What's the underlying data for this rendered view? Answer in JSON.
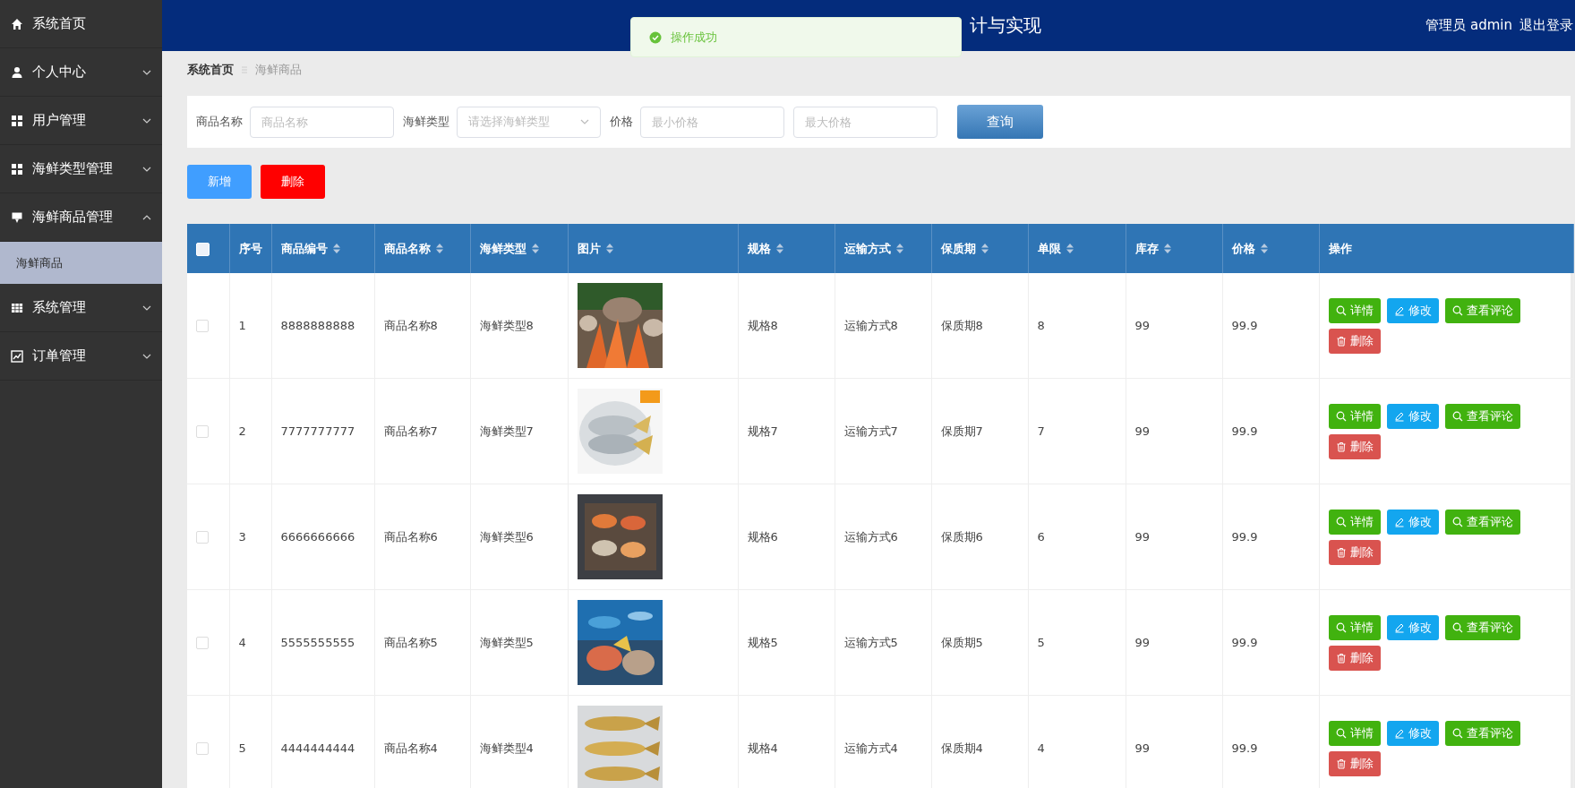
{
  "sidebar": {
    "items": [
      {
        "kind": "link",
        "label": "系统首页"
      },
      {
        "kind": "menu",
        "label": "个人中心",
        "expanded": false
      },
      {
        "kind": "menu",
        "label": "用户管理",
        "expanded": false
      },
      {
        "kind": "menu",
        "label": "海鲜类型管理",
        "expanded": false
      },
      {
        "kind": "menu",
        "label": "海鲜商品管理",
        "expanded": true,
        "children": [
          {
            "label": "海鲜商品",
            "selected": true
          }
        ]
      },
      {
        "kind": "menu",
        "label": "系统管理",
        "expanded": false
      },
      {
        "kind": "menu",
        "label": "订单管理",
        "expanded": false
      }
    ]
  },
  "header": {
    "title": "计与实现",
    "user": "管理员 admin",
    "logout": "退出登录"
  },
  "toast": {
    "kind": "success",
    "message": "操作成功"
  },
  "breadcrumb": [
    "系统首页",
    "海鲜商品"
  ],
  "search": {
    "fields": [
      {
        "kind": "input",
        "label": "商品名称",
        "placeholder": "商品名称"
      },
      {
        "kind": "select",
        "label": "海鲜类型",
        "placeholder": "请选择海鲜类型"
      },
      {
        "kind": "input",
        "label": "价格",
        "placeholder": "最小价格"
      },
      {
        "kind": "input",
        "placeholder": "最大价格"
      }
    ],
    "button": "查询"
  },
  "actions": [
    {
      "kind": "add",
      "label": "新增"
    },
    {
      "kind": "delete",
      "label": "删除"
    }
  ],
  "table": {
    "select_all": false,
    "columns": [
      {
        "label": "序号",
        "sortable": false
      },
      {
        "label": "商品编号",
        "sortable": true
      },
      {
        "label": "商品名称",
        "sortable": true
      },
      {
        "label": "海鲜类型",
        "sortable": true
      },
      {
        "label": "图片",
        "sortable": true
      },
      {
        "label": "规格",
        "sortable": true
      },
      {
        "label": "运输方式",
        "sortable": true
      },
      {
        "label": "保质期",
        "sortable": true
      },
      {
        "label": "单限",
        "sortable": true
      },
      {
        "label": "库存",
        "sortable": true
      },
      {
        "label": "价格",
        "sortable": true
      },
      {
        "label": "操作",
        "sortable": false
      }
    ],
    "rows": [
      {
        "checked": false,
        "cells": [
          "1",
          "8888888888",
          "商品名称8",
          "海鲜类型8",
          {
            "kind": "picture"
          },
          "规格8",
          "运输方式8",
          "保质期8",
          "8",
          "99",
          "99.9"
        ],
        "buttons": [
          {
            "kind": "detail",
            "label": "详情"
          },
          {
            "kind": "edit",
            "label": "修改"
          },
          {
            "kind": "review",
            "label": "查看评论"
          },
          {
            "kind": "delete",
            "label": "删除"
          }
        ]
      },
      {
        "checked": false,
        "cells": [
          "2",
          "7777777777",
          "商品名称7",
          "海鲜类型7",
          {
            "kind": "picture"
          },
          "规格7",
          "运输方式7",
          "保质期7",
          "7",
          "99",
          "99.9"
        ],
        "buttons": [
          {
            "kind": "detail",
            "label": "详情"
          },
          {
            "kind": "edit",
            "label": "修改"
          },
          {
            "kind": "review",
            "label": "查看评论"
          },
          {
            "kind": "delete",
            "label": "删除"
          }
        ]
      },
      {
        "checked": false,
        "cells": [
          "3",
          "6666666666",
          "商品名称6",
          "海鲜类型6",
          {
            "kind": "picture"
          },
          "规格6",
          "运输方式6",
          "保质期6",
          "6",
          "99",
          "99.9"
        ],
        "buttons": [
          {
            "kind": "detail",
            "label": "详情"
          },
          {
            "kind": "edit",
            "label": "修改"
          },
          {
            "kind": "review",
            "label": "查看评论"
          },
          {
            "kind": "delete",
            "label": "删除"
          }
        ]
      },
      {
        "checked": false,
        "cells": [
          "4",
          "5555555555",
          "商品名称5",
          "海鲜类型5",
          {
            "kind": "picture"
          },
          "规格5",
          "运输方式5",
          "保质期5",
          "5",
          "99",
          "99.9"
        ],
        "buttons": [
          {
            "kind": "detail",
            "label": "详情"
          },
          {
            "kind": "edit",
            "label": "修改"
          },
          {
            "kind": "review",
            "label": "查看评论"
          },
          {
            "kind": "delete",
            "label": "删除"
          }
        ]
      },
      {
        "checked": false,
        "cells": [
          "5",
          "4444444444",
          "商品名称4",
          "海鲜类型4",
          {
            "kind": "picture"
          },
          "规格4",
          "运输方式4",
          "保质期4",
          "4",
          "99",
          "99.9"
        ],
        "buttons": [
          {
            "kind": "detail",
            "label": "详情"
          },
          {
            "kind": "edit",
            "label": "修改"
          },
          {
            "kind": "review",
            "label": "查看评论"
          },
          {
            "kind": "delete",
            "label": "删除"
          }
        ]
      }
    ]
  }
}
